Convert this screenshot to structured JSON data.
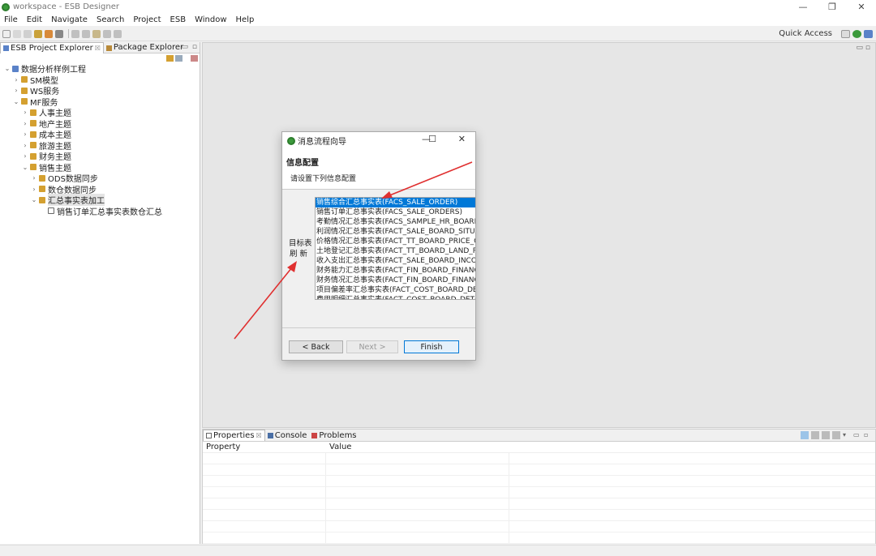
{
  "window": {
    "title": "workspace - ESB Designer",
    "controls": [
      "—",
      "❐",
      "✕"
    ]
  },
  "menu": [
    "File",
    "Edit",
    "Navigate",
    "Search",
    "Project",
    "ESB",
    "Window",
    "Help"
  ],
  "toolbar": {
    "quick_access": "Quick Access"
  },
  "left_panel": {
    "tabs": [
      {
        "label": "ESB Project Explorer",
        "close": "☒"
      },
      {
        "label": "Package Explorer"
      }
    ],
    "tree": [
      {
        "label": "数据分析样例工程",
        "level": 0,
        "arrow": "⌄",
        "icon": "project"
      },
      {
        "label": "SM模型",
        "level": 1,
        "arrow": "›",
        "icon": "folder"
      },
      {
        "label": "WS服务",
        "level": 1,
        "arrow": "›",
        "icon": "folder"
      },
      {
        "label": "MF服务",
        "level": 1,
        "arrow": "⌄",
        "icon": "folder"
      },
      {
        "label": "人事主题",
        "level": 2,
        "arrow": "›",
        "icon": "folder"
      },
      {
        "label": "地产主题",
        "level": 2,
        "arrow": "›",
        "icon": "folder"
      },
      {
        "label": "成本主题",
        "level": 2,
        "arrow": "›",
        "icon": "folder"
      },
      {
        "label": "旅游主题",
        "level": 2,
        "arrow": "›",
        "icon": "folder"
      },
      {
        "label": "财务主题",
        "level": 2,
        "arrow": "›",
        "icon": "folder"
      },
      {
        "label": "销售主题",
        "level": 2,
        "arrow": "⌄",
        "icon": "folder"
      },
      {
        "label": "ODS数据同步",
        "level": 3,
        "arrow": "›",
        "icon": "folder"
      },
      {
        "label": "数仓数据同步",
        "level": 3,
        "arrow": "›",
        "icon": "folder"
      },
      {
        "label": "汇总事实表加工",
        "level": 3,
        "arrow": "⌄",
        "icon": "folder",
        "selected": true
      },
      {
        "label": "销售订单汇总事实表数仓汇总",
        "level": 4,
        "arrow": "",
        "icon": "file"
      }
    ]
  },
  "bottom_panel": {
    "tabs": [
      {
        "label": "Properties",
        "close": "☒"
      },
      {
        "label": "Console"
      },
      {
        "label": "Problems"
      }
    ],
    "columns": [
      "Property",
      "Value"
    ]
  },
  "dialog": {
    "title": "消息流程向导",
    "header_title": "信息配置",
    "header_subtitle": "请设置下列信息配置",
    "field_label": "目标表",
    "refresh": "刷 新",
    "items": [
      "销售综合汇总事实表(FACS_SALE_ORDER)",
      "销售订单汇总事实表(FACS_SALE_ORDERS)",
      "考勤情况汇总事实表(FACS_SAMPLE_HR_BOARD",
      "利润情况汇总事实表(FACT_SALE_BOARD_SITUA",
      "价格情况汇总事实表(FACT_TT_BOARD_PRICE_C",
      "土地登记汇总事实表(FACT_TT_BOARD_LAND_R",
      "收入支出汇总事实表(FACT_SALE_BOARD_INCOI",
      "财务能力汇总事实表(FACT_FIN_BOARD_FINANC",
      "财务情况汇总事实表(FACT_FIN_BOARD_FINANC",
      "项目偏差率汇总事实表(FACT_COST_BOARD_DEV",
      "费用明细汇总事实表(FACT_COST_BOARD_DETA"
    ],
    "selected_index": 0,
    "buttons": {
      "back": "< Back",
      "next": "Next >",
      "finish": "Finish"
    }
  },
  "colors": {
    "selection": "#0078d7",
    "annotation_arrow": "#e03030",
    "brand_icon": "#3c9a3c"
  }
}
